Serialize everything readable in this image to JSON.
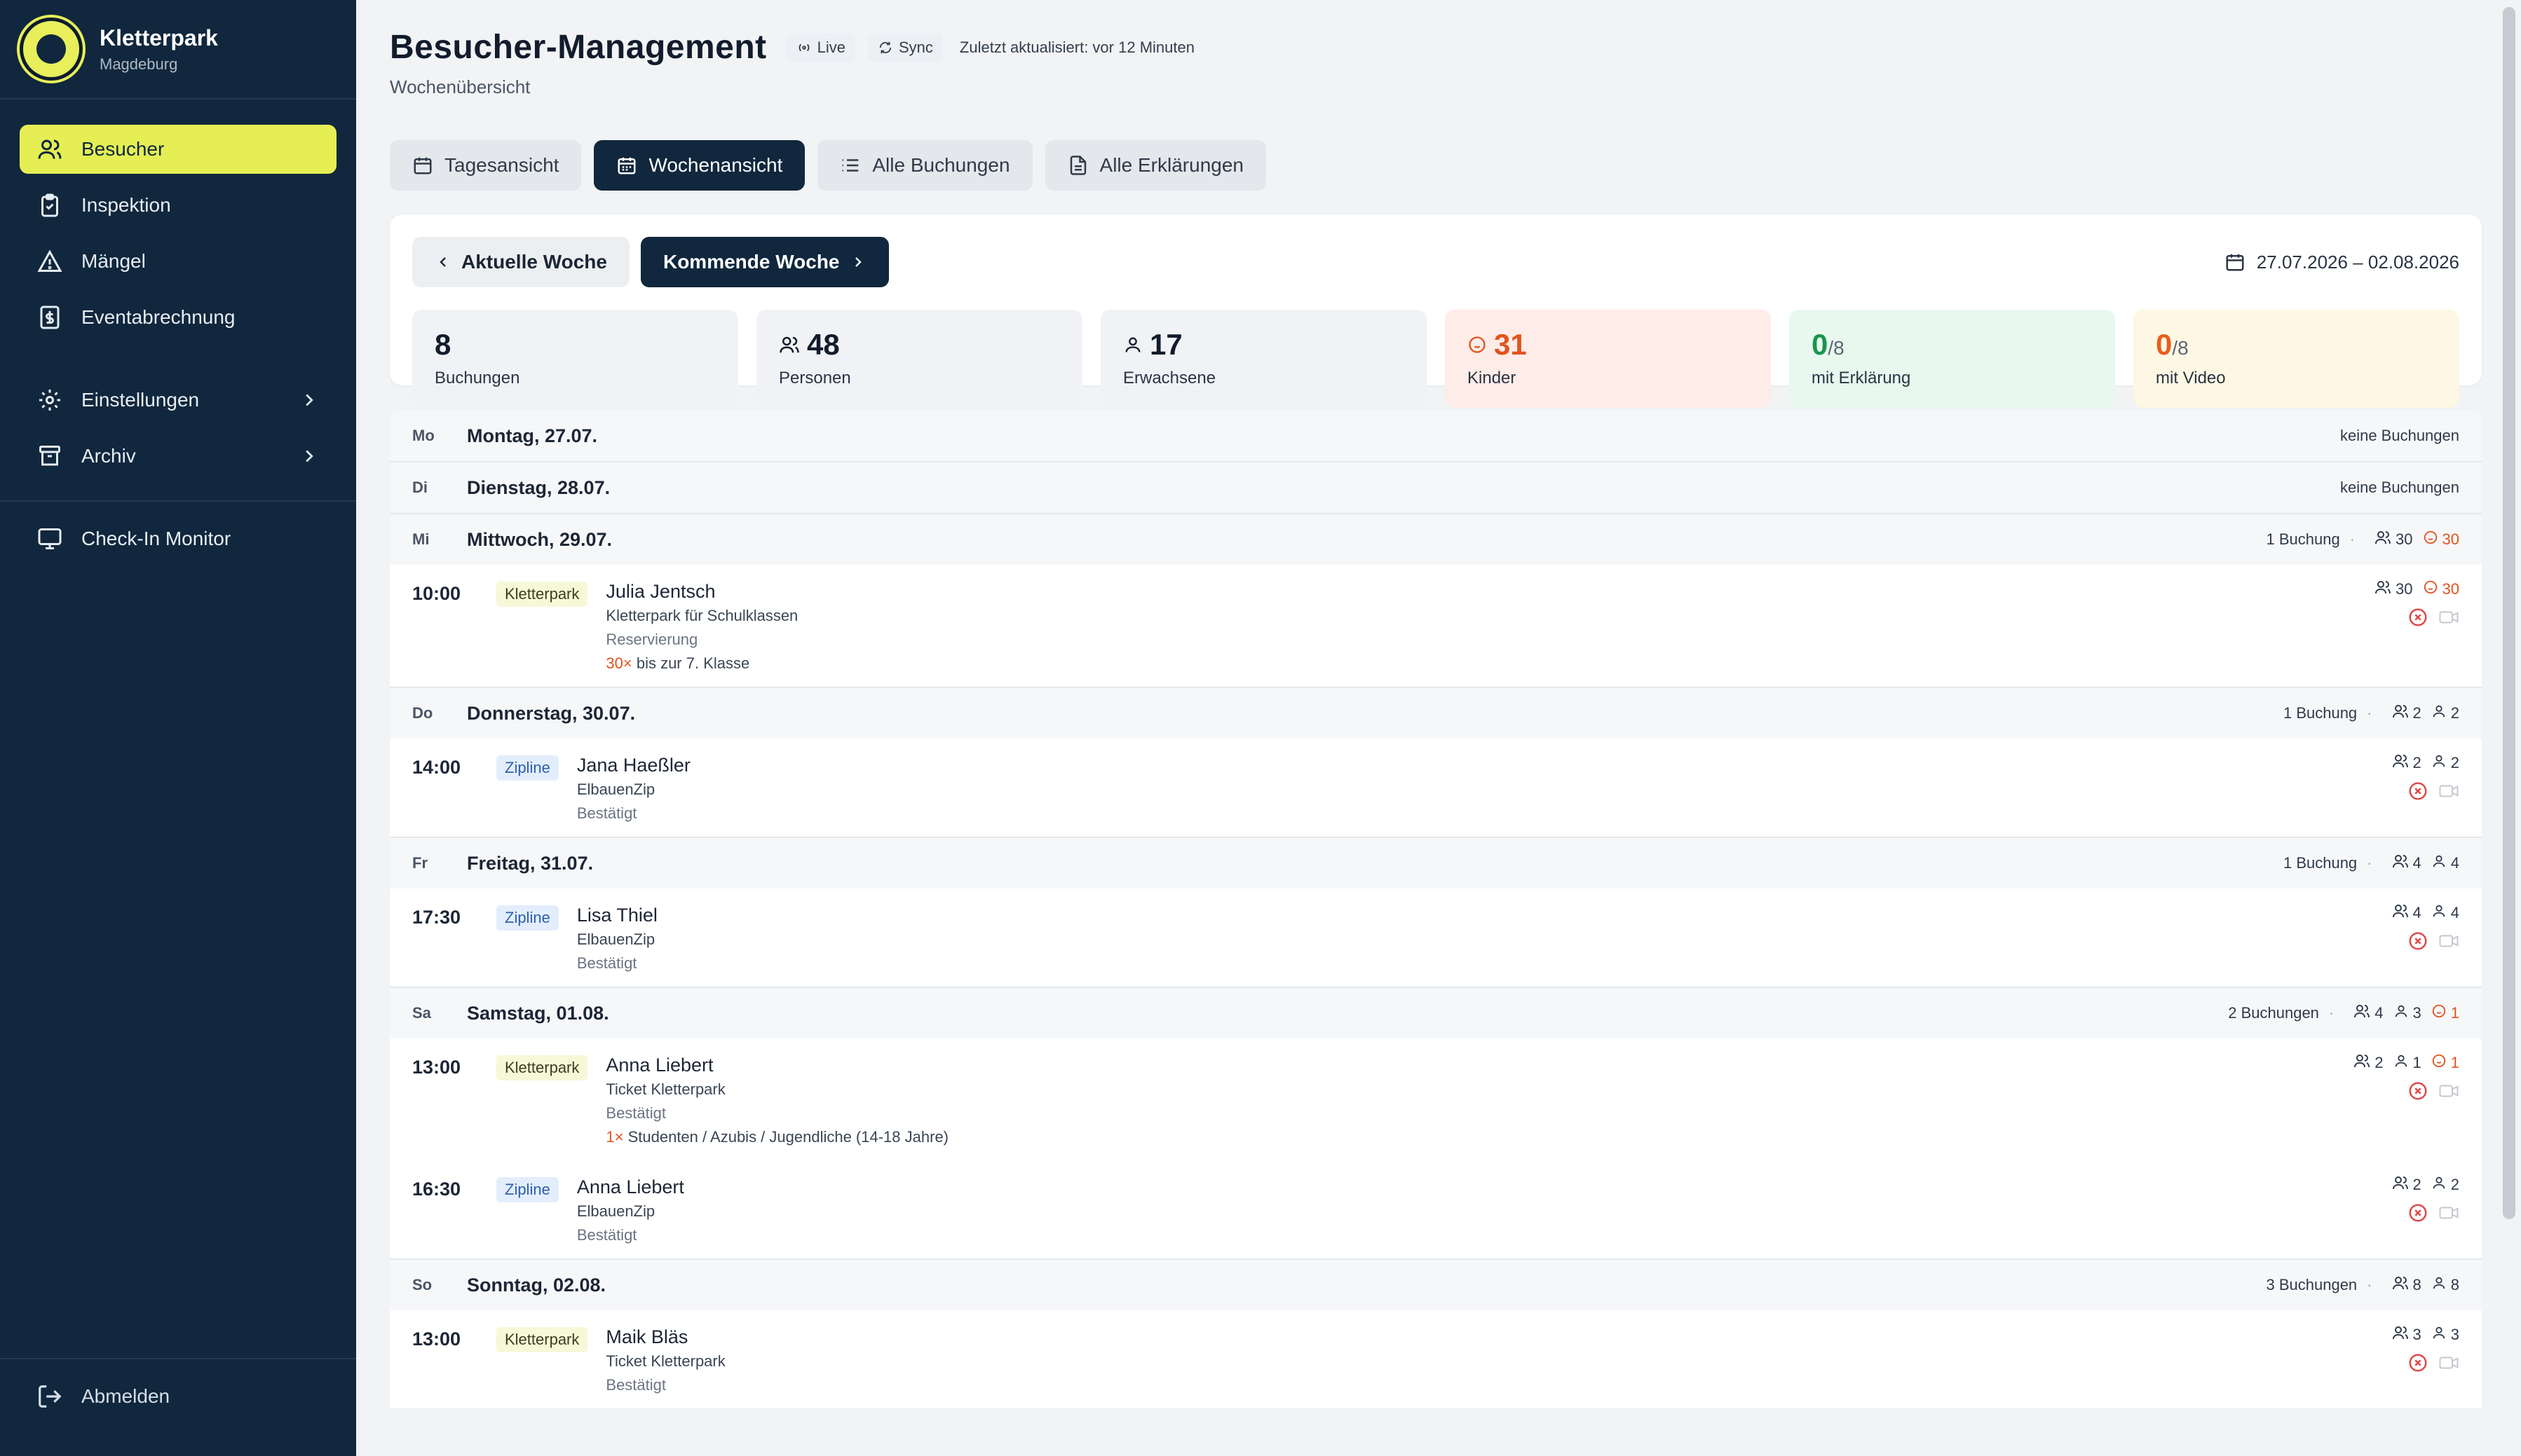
{
  "brand": {
    "name": "Kletterpark",
    "sub": "Magdeburg"
  },
  "nav": {
    "items": [
      {
        "label": "Besucher"
      },
      {
        "label": "Inspektion"
      },
      {
        "label": "Mängel"
      },
      {
        "label": "Eventabrechnung"
      },
      {
        "label": "Einstellungen"
      },
      {
        "label": "Archiv"
      },
      {
        "label": "Check-In Monitor"
      }
    ],
    "logout": "Abmelden"
  },
  "header": {
    "title": "Besucher-Management",
    "live": "Live",
    "sync": "Sync",
    "updated": "Zuletzt aktualisiert: vor 12 Minuten",
    "subtitle": "Wochenübersicht"
  },
  "tabs": [
    "Tagesansicht",
    "Wochenansicht",
    "Alle Buchungen",
    "Alle Erklärungen"
  ],
  "week": {
    "prev": "Aktuelle Woche",
    "next": "Kommende Woche",
    "range": "27.07.2026 – 02.08.2026"
  },
  "stats": [
    {
      "value": "8",
      "label": "Buchungen"
    },
    {
      "value": "48",
      "label": "Personen"
    },
    {
      "value": "17",
      "label": "Erwachsene"
    },
    {
      "value": "31",
      "label": "Kinder"
    },
    {
      "value": "0",
      "frac": "/8",
      "label": "mit Erklärung"
    },
    {
      "value": "0",
      "frac": "/8",
      "label": "mit Video"
    }
  ],
  "days": [
    {
      "abbr": "Mo",
      "name": "Montag, 27.07.",
      "summary": "keine Buchungen"
    },
    {
      "abbr": "Di",
      "name": "Dienstag, 28.07.",
      "summary": "keine Buchungen"
    },
    {
      "abbr": "Mi",
      "name": "Mittwoch, 29.07.",
      "summary": "1 Buchung",
      "persons": "30",
      "kids": "30",
      "bookings": [
        {
          "time": "10:00",
          "badge": "Kletterpark",
          "name": "Julia Jentsch",
          "product": "Kletterpark für Schulklassen",
          "status": "Reservierung",
          "extra_count": "30×",
          "extra_text": " bis zur 7. Klasse",
          "persons": "30",
          "kids": "30"
        }
      ]
    },
    {
      "abbr": "Do",
      "name": "Donnerstag, 30.07.",
      "summary": "1 Buchung",
      "persons": "2",
      "adults": "2",
      "bookings": [
        {
          "time": "14:00",
          "badge": "Zipline",
          "name": "Jana Haeßler",
          "product": "ElbauenZip",
          "status": "Bestätigt",
          "persons": "2",
          "adults": "2"
        }
      ]
    },
    {
      "abbr": "Fr",
      "name": "Freitag, 31.07.",
      "summary": "1 Buchung",
      "persons": "4",
      "adults": "4",
      "bookings": [
        {
          "time": "17:30",
          "badge": "Zipline",
          "name": "Lisa Thiel",
          "product": "ElbauenZip",
          "status": "Bestätigt",
          "persons": "4",
          "adults": "4"
        }
      ]
    },
    {
      "abbr": "Sa",
      "name": "Samstag, 01.08.",
      "summary": "2 Buchungen",
      "persons": "4",
      "adults": "3",
      "kids": "1",
      "bookings": [
        {
          "time": "13:00",
          "badge": "Kletterpark",
          "name": "Anna Liebert",
          "product": "Ticket Kletterpark",
          "status": "Bestätigt",
          "extra_count": "1×",
          "extra_text": " Studenten / Azubis / Jugendliche (14-18 Jahre)",
          "persons": "2",
          "adults": "1",
          "kids": "1"
        },
        {
          "time": "16:30",
          "badge": "Zipline",
          "name": "Anna Liebert",
          "product": "ElbauenZip",
          "status": "Bestätigt",
          "persons": "2",
          "adults": "2"
        }
      ]
    },
    {
      "abbr": "So",
      "name": "Sonntag, 02.08.",
      "summary": "3 Buchungen",
      "persons": "8",
      "adults": "8",
      "bookings": [
        {
          "time": "13:00",
          "badge": "Kletterpark",
          "name": "Maik Bläs",
          "product": "Ticket Kletterpark",
          "status": "Bestätigt",
          "persons": "3",
          "adults": "3"
        }
      ]
    }
  ],
  "colors": {
    "sidebar": "#10273d",
    "accent": "#e5ef54",
    "kids": "#e2531e",
    "green": "#199550"
  },
  "icons": [
    "users-icon",
    "clipboard-check-icon",
    "warning-icon",
    "receipt-icon",
    "gear-icon",
    "archive-icon",
    "monitor-icon",
    "logout-icon",
    "calendar-icon",
    "list-icon",
    "document-icon",
    "user-icon",
    "smile-icon",
    "x-circle-icon",
    "video-icon"
  ]
}
